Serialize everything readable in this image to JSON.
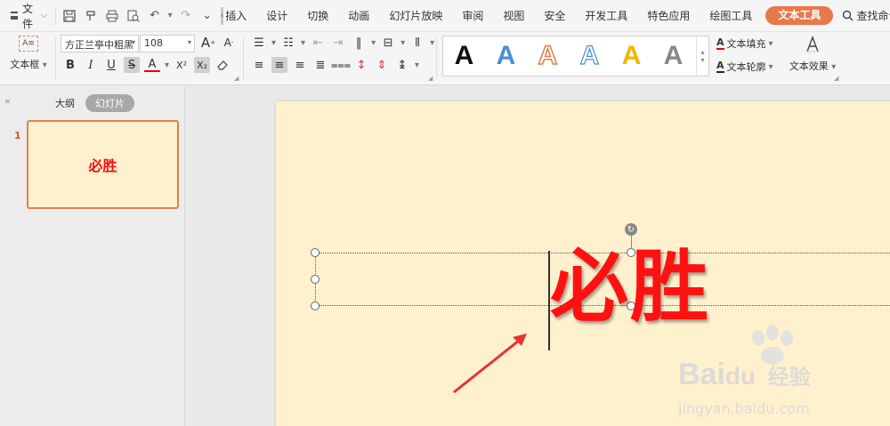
{
  "menubar": {
    "file_label": "文件",
    "tabs": [
      "插入",
      "设计",
      "切换",
      "动画",
      "幻灯片放映",
      "审阅",
      "视图",
      "安全",
      "开发工具",
      "特色应用",
      "绘图工具",
      "文本工具"
    ],
    "active_tab": "文本工具",
    "search_label": "查找命令"
  },
  "ribbon": {
    "textbox_label": "文本框",
    "font_name": "方正兰亭中粗黑",
    "font_size": "108",
    "grow_font": "A",
    "shrink_font": "A",
    "bold": "B",
    "italic": "I",
    "underline": "U",
    "strike": "S",
    "font_color": "A",
    "superscript": "X²",
    "subscript": "X₂",
    "style_letters": [
      "A",
      "A",
      "A",
      "A",
      "A",
      "A"
    ],
    "text_fill_label": "文本填充",
    "text_outline_label": "文本轮廓",
    "text_effect_label": "文本效果",
    "colors": {
      "accent": "#e8794a",
      "text_red": "#ff1111"
    }
  },
  "panel": {
    "outline_tab": "大纲",
    "slides_tab": "幻灯片",
    "slide_number": "1",
    "thumb_text": "必胜"
  },
  "slide": {
    "main_text": "必胜"
  },
  "watermark": {
    "brand": "Bai",
    "brand_cn": "经验",
    "url": "jingyan.baidu.com"
  }
}
